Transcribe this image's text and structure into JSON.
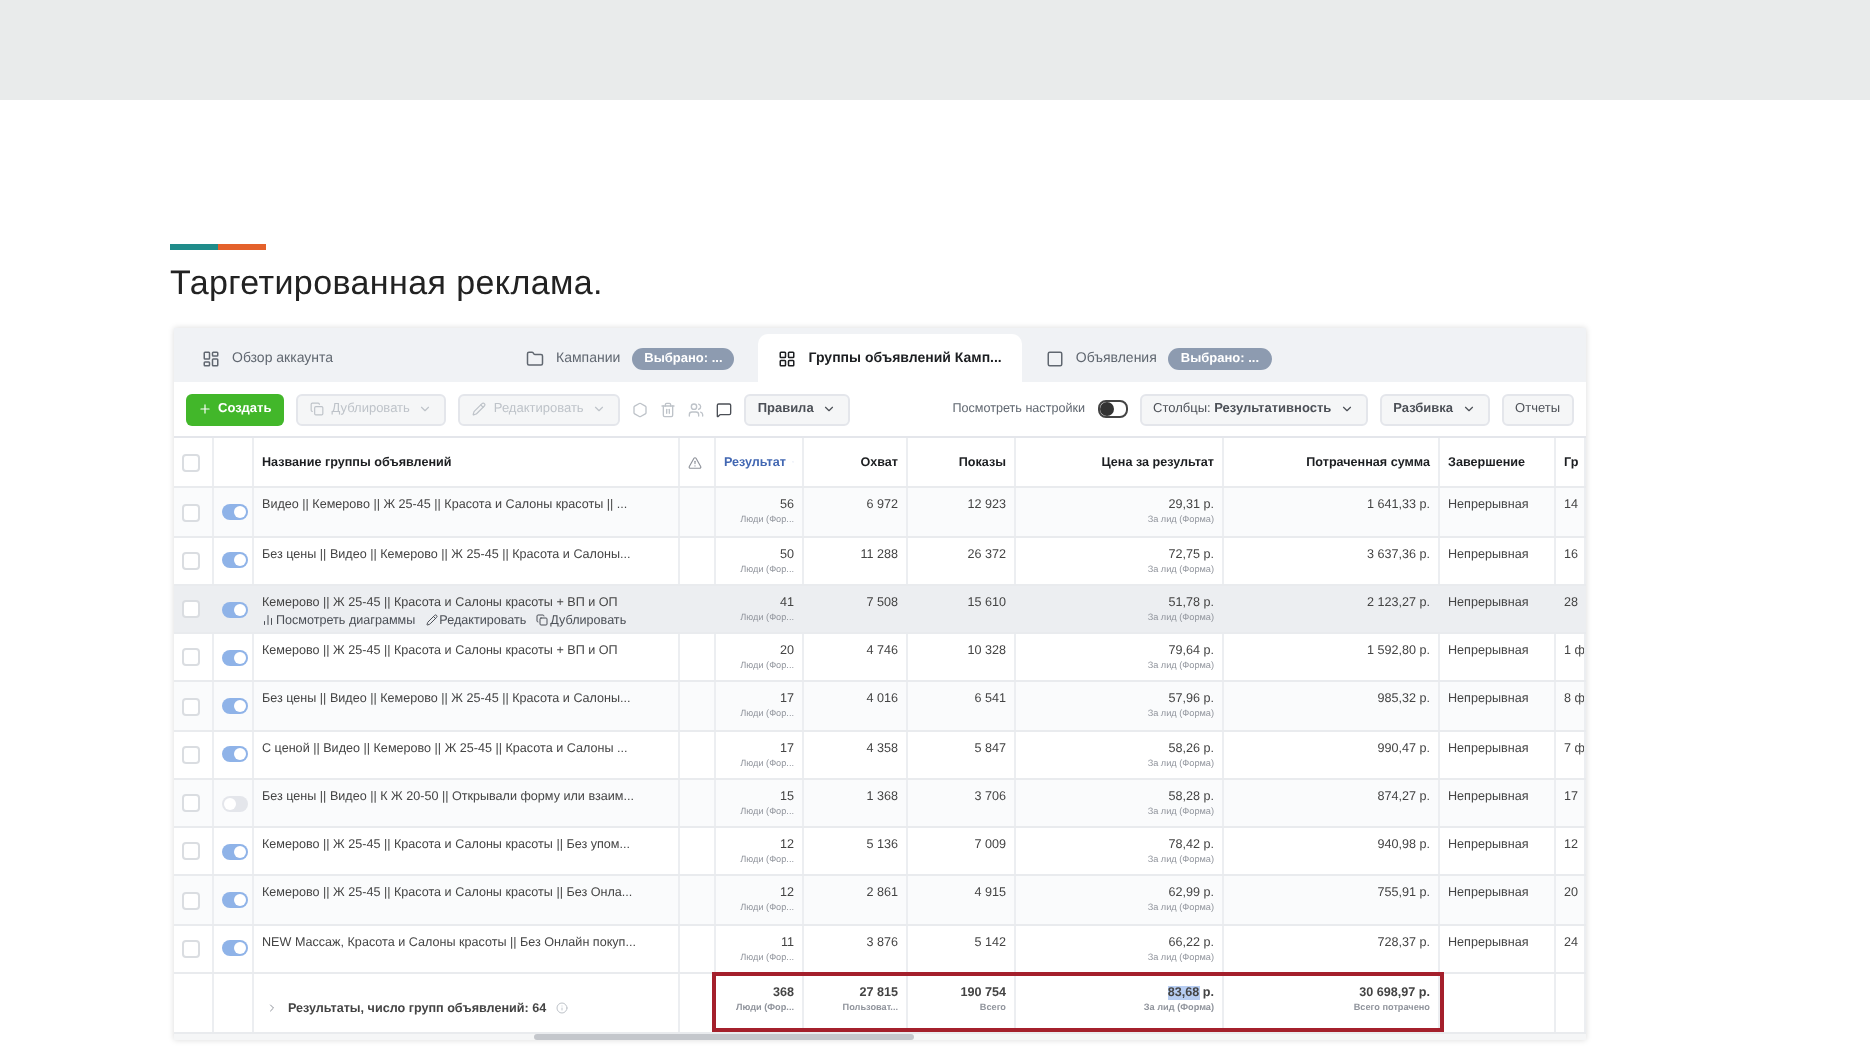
{
  "slide": {
    "title": "Таргетированная реклама."
  },
  "tabs": [
    {
      "kind": "overview",
      "label": "Обзор аккаунта",
      "selected": false
    },
    {
      "kind": "campaigns",
      "label": "Кампании",
      "selected": false,
      "badge": "Выбрано: ..."
    },
    {
      "kind": "adsets",
      "label": "Группы объявлений Камп...",
      "selected": true
    },
    {
      "kind": "ads",
      "label": "Объявления",
      "selected": false,
      "badge": "Выбрано: ..."
    }
  ],
  "toolbar": {
    "create": "Создать",
    "duplicate": {
      "label": "Дублировать",
      "disabled": true
    },
    "edit": {
      "label": "Редактировать",
      "disabled": true
    },
    "rules": "Правила",
    "settings": {
      "label": "Посмотреть настройки",
      "on": false
    },
    "columns": "Столбцы: **Результативность**",
    "breakdown": "Разбивка",
    "reports": "Отчеты"
  },
  "select_all": {
    "checked": false
  },
  "columns": [
    "Название группы объявлений",
    "Результат",
    "Охват",
    "Показы",
    "Цена за результат",
    "Потраченная сумма",
    "Завершение",
    "Гр"
  ],
  "rows": [
    {
      "name": "Видео || Кемерово || Ж 25-45 || Красота и Салоны красоты || ...",
      "checked": false,
      "active": true,
      "hovered": false,
      "result": "56",
      "result_sub": "Люди (Фор...",
      "reach": "6 972",
      "impressions": "12 923",
      "cost": "29,31 р.",
      "cost_sub": "За лид (Форма)",
      "spent": "1 641,33 р.",
      "end": "Непрерывная",
      "column_9": "14"
    },
    {
      "name": "Без цены || Видео || Кемерово || Ж 25-45 || Красота и Салоны...",
      "checked": false,
      "active": true,
      "hovered": false,
      "result": "50",
      "result_sub": "Люди (Фор...",
      "reach": "11 288",
      "impressions": "26 372",
      "cost": "72,75 р.",
      "cost_sub": "За лид (Форма)",
      "spent": "3 637,36 р.",
      "end": "Непрерывная",
      "column_9": "16"
    },
    {
      "name": "Кемерово || Ж 25-45 || Красота и Салоны красоты + ВП и ОП",
      "checked": false,
      "active": true,
      "hovered": true,
      "actions": [
        "Посмотреть диаграммы",
        "Редактировать",
        "Дублировать"
      ],
      "result": "41",
      "result_sub": "Люди (Фор...",
      "reach": "7 508",
      "impressions": "15 610",
      "cost": "51,78 р.",
      "cost_sub": "За лид (Форма)",
      "spent": "2 123,27 р.",
      "end": "Непрерывная",
      "column_9": "28"
    },
    {
      "name": "Кемерово || Ж 25-45 || Красота и Салоны красоты + ВП и ОП",
      "checked": false,
      "active": true,
      "hovered": false,
      "result": "20",
      "result_sub": "Люди (Фор...",
      "reach": "4 746",
      "impressions": "10 328",
      "cost": "79,64 р.",
      "cost_sub": "За лид (Форма)",
      "spent": "1 592,80 р.",
      "end": "Непрерывная",
      "column_9": "1 ф"
    },
    {
      "name": "Без цены || Видео || Кемерово || Ж 25-45 || Красота и Салоны...",
      "checked": false,
      "active": true,
      "hovered": false,
      "result": "17",
      "result_sub": "Люди (Фор...",
      "reach": "4 016",
      "impressions": "6 541",
      "cost": "57,96 р.",
      "cost_sub": "За лид (Форма)",
      "spent": "985,32 р.",
      "end": "Непрерывная",
      "column_9": "8 ф"
    },
    {
      "name": "С ценой || Видео || Кемерово || Ж 25-45 || Красота и Салоны ...",
      "checked": false,
      "active": true,
      "hovered": false,
      "result": "17",
      "result_sub": "Люди (Фор...",
      "reach": "4 358",
      "impressions": "5 847",
      "cost": "58,26 р.",
      "cost_sub": "За лид (Форма)",
      "spent": "990,47 р.",
      "end": "Непрерывная",
      "column_9": "7 ф"
    },
    {
      "name": "Без цены || Видео || К Ж 20-50 || Открывали форму или взаим...",
      "checked": false,
      "active": false,
      "hovered": false,
      "result": "15",
      "result_sub": "Люди (Фор...",
      "reach": "1 368",
      "impressions": "3 706",
      "cost": "58,28 р.",
      "cost_sub": "За лид (Форма)",
      "spent": "874,27 р.",
      "end": "Непрерывная",
      "column_9": "17"
    },
    {
      "name": "Кемерово || Ж 25-45 || Красота и Салоны красоты || Без упом...",
      "checked": false,
      "active": true,
      "hovered": false,
      "result": "12",
      "result_sub": "Люди (Фор...",
      "reach": "5 136",
      "impressions": "7 009",
      "cost": "78,42 р.",
      "cost_sub": "За лид (Форма)",
      "spent": "940,98 р.",
      "end": "Непрерывная",
      "column_9": "12"
    },
    {
      "name": "Кемерово || Ж 25-45 || Красота и Салоны красоты || Без Онла...",
      "checked": false,
      "active": true,
      "hovered": false,
      "result": "12",
      "result_sub": "Люди (Фор...",
      "reach": "2 861",
      "impressions": "4 915",
      "cost": "62,99 р.",
      "cost_sub": "За лид (Форма)",
      "spent": "755,91 р.",
      "end": "Непрерывная",
      "column_9": "20"
    },
    {
      "name": "NEW Массаж, Красота и Салоны красоты || Без Онлайн покуп...",
      "checked": false,
      "active": true,
      "hovered": false,
      "result": "11",
      "result_sub": "Люди (Фор...",
      "reach": "3 876",
      "impressions": "5 142",
      "cost": "66,22 р.",
      "cost_sub": "За лид (Форма)",
      "spent": "728,37 р.",
      "end": "Непрерывная",
      "column_9": "24"
    }
  ],
  "summary": {
    "label": "Результаты, число групп объявлений: 64",
    "highlighted": true,
    "result": "368",
    "result_sub": "Люди (Фор...",
    "reach": "27 815",
    "reach_sub": "Пользоват...",
    "impressions": "190 754",
    "impressions_sub": "Всего",
    "cost_selected": "83,68",
    "cost_rest": " р.",
    "cost_sub": "За лид (Форма)",
    "spent": "30 698,97 р.",
    "spent_sub": "Всего потрачено"
  }
}
